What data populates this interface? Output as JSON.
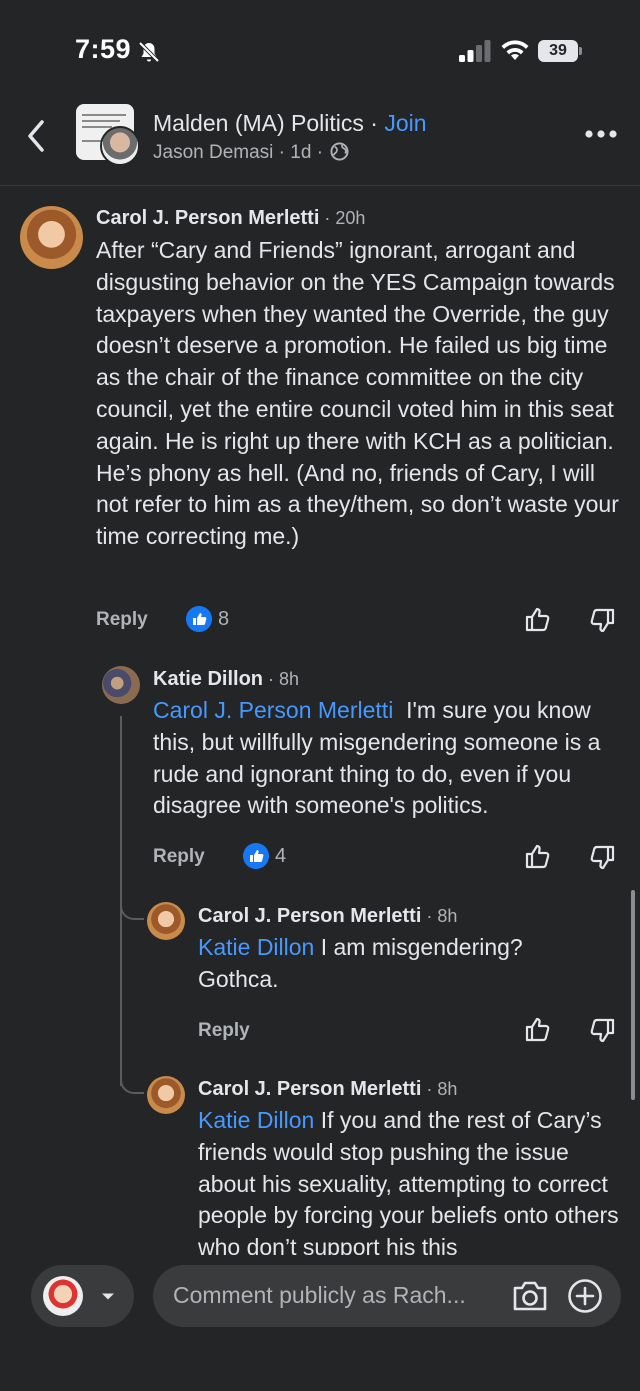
{
  "status": {
    "time": "7:59",
    "battery": "39"
  },
  "header": {
    "group_name": "Malden (MA) Politics",
    "separator": " · ",
    "join_label": "Join",
    "poster": "Jason Demasi",
    "age": "1d"
  },
  "comments": [
    {
      "author": "Carol J. Person Merletti",
      "time": "20h",
      "text": "After “Cary and Friends” ignorant, arrogant and disgusting behavior on the YES Campaign towards taxpayers when they wanted the Override, the guy doesn’t deserve a promotion. He failed us big time as the chair of the finance committee on the city council, yet the entire council voted him in this seat again. He is right up there with KCH as a politician. He’s phony as hell. (And no, friends of Cary, I will not refer to him as a they/them, so don’t waste your time correcting me.)",
      "reply_label": "Reply",
      "likes": "8"
    },
    {
      "author": "Katie Dillon",
      "time": "8h",
      "mention": "Carol J. Person Merletti",
      "text": "I'm sure you know this, but willfully misgendering someone is a rude and ignorant thing to do, even if you disagree with someone's politics.",
      "reply_label": "Reply",
      "likes": "4"
    },
    {
      "author": "Carol J. Person Merletti",
      "time": "8h",
      "mention": "Katie Dillon",
      "text": "I am misgendering? Gothca.",
      "reply_label": "Reply"
    },
    {
      "author": "Carol J. Person Merletti",
      "time": "8h",
      "mention": "Katie Dillon",
      "text": "If you and the rest of Cary’s friends would stop pushing the issue about his sexuality, attempting to correct people by forcing your beliefs onto others who don’t support his this"
    }
  ],
  "composer": {
    "placeholder": "Comment publicly as Rach..."
  },
  "colors": {
    "background": "#242526",
    "link": "#4599ff",
    "like": "#1877f2"
  },
  "icons": [
    "bell-slash-icon",
    "signal-icon",
    "wifi-icon",
    "battery-icon",
    "back-chevron-icon",
    "globe-icon",
    "more-icon",
    "like-icon",
    "thumbs-up-icon",
    "thumbs-down-icon",
    "caret-down-icon",
    "camera-icon",
    "plus-circle-icon"
  ]
}
